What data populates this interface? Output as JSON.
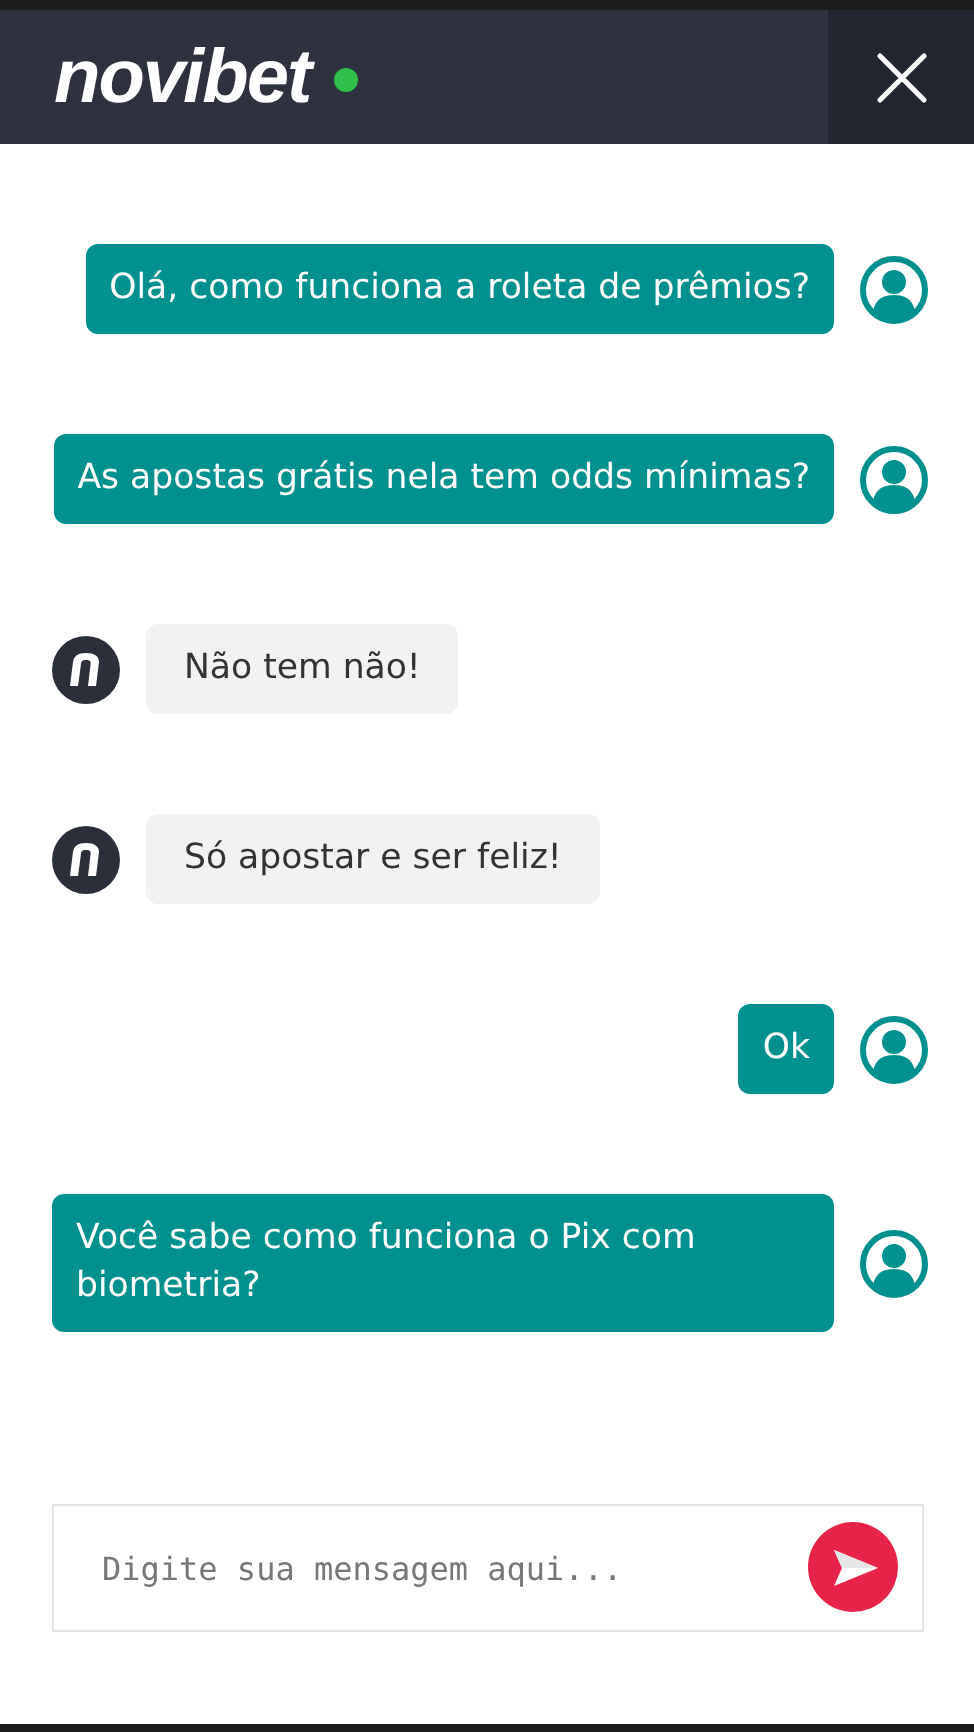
{
  "header": {
    "logo": "novibet",
    "online": true
  },
  "messages": [
    {
      "kind": "user",
      "text": "Olá, como funciona a roleta de prêmios?"
    },
    {
      "kind": "user",
      "text": "As apostas grátis nela tem odds mínimas?"
    },
    {
      "kind": "bot",
      "text": "Não tem não!"
    },
    {
      "kind": "bot",
      "text": "Só apostar e ser feliz!"
    },
    {
      "kind": "user",
      "text": "Ok"
    },
    {
      "kind": "user",
      "text": "Você sabe como funciona o Pix com biometria?"
    }
  ],
  "composer": {
    "placeholder": "Digite sua mensagem aqui..."
  }
}
